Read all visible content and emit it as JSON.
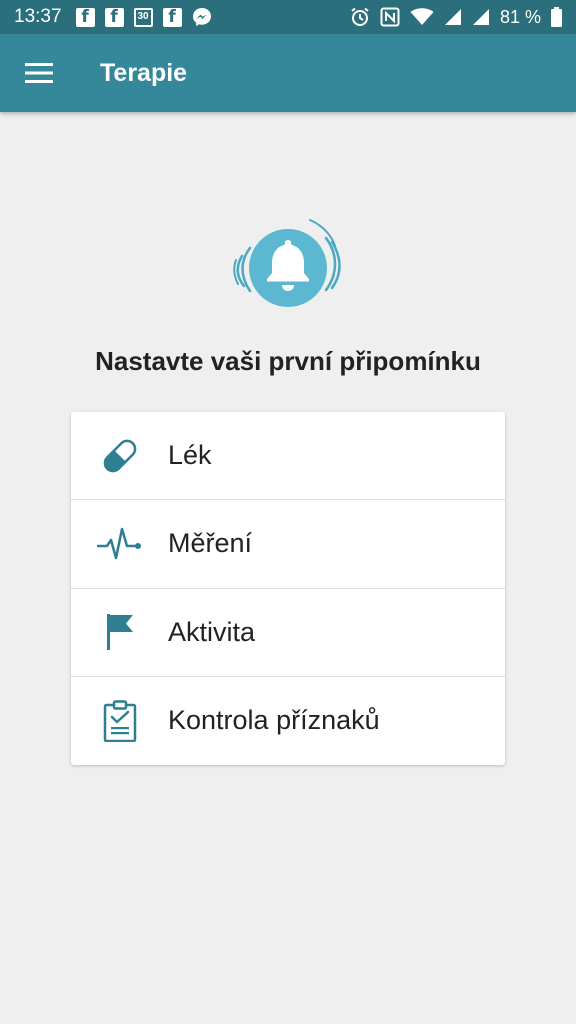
{
  "status_bar": {
    "time": "13:37",
    "calendar_day": "30",
    "battery": "81 %"
  },
  "app_bar": {
    "title": "Terapie",
    "menu_icon": "hamburger-menu-icon"
  },
  "main": {
    "heading": "Nastavte vaši první připomínku",
    "bell_icon": "bell-ringing-icon",
    "options": [
      {
        "label": "Lék",
        "icon": "pill-icon"
      },
      {
        "label": "Měření",
        "icon": "heartbeat-icon"
      },
      {
        "label": "Aktivita",
        "icon": "flag-icon"
      },
      {
        "label": "Kontrola příznaků",
        "icon": "clipboard-check-icon"
      }
    ]
  },
  "colors": {
    "status_bar": "#2b6f7c",
    "app_bar": "#35889a",
    "accent": "#2e7f91",
    "bell_circle": "#5bb8d0",
    "background": "#efefef"
  }
}
